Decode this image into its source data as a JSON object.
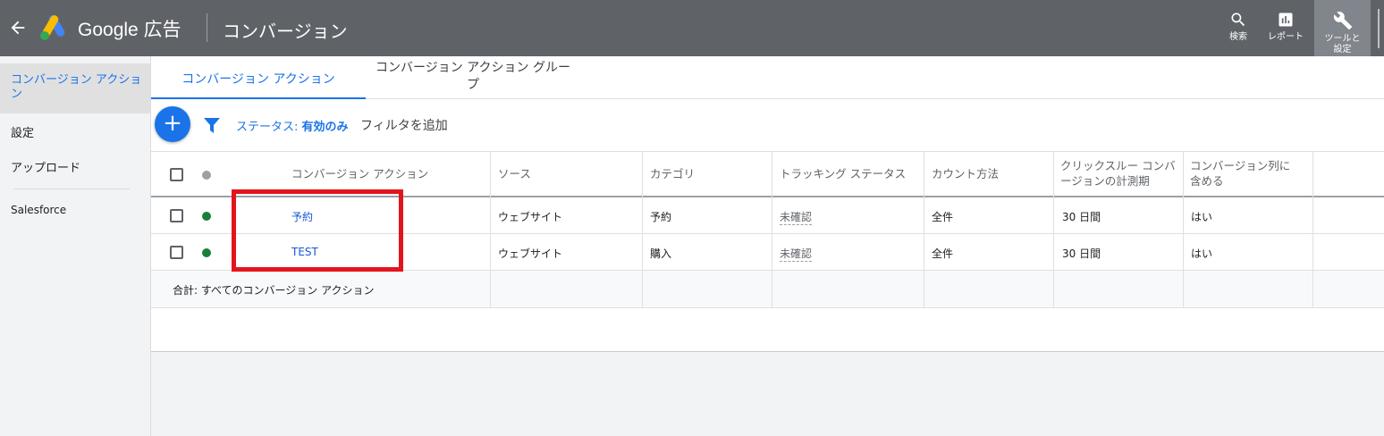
{
  "topbar": {
    "brand": "Google 広告",
    "page_title": "コンバージョン",
    "search_label": "検索",
    "report_label": "レポート",
    "tools_label": "ツールと設定"
  },
  "sidebar": {
    "items": [
      {
        "label": "コンバージョン アクション"
      },
      {
        "label": "設定"
      },
      {
        "label": "アップロード"
      },
      {
        "label": "Salesforce"
      }
    ]
  },
  "tabs": [
    {
      "label": "コンバージョン アクション"
    },
    {
      "label": "コンバージョン アクション グループ"
    }
  ],
  "filters": {
    "status_prefix": "ステータス:",
    "status_value": "有効のみ",
    "add_filter": "フィルタを追加"
  },
  "table": {
    "headers": {
      "action": "コンバージョン アクション",
      "source": "ソース",
      "category": "カテゴリ",
      "tracking": "トラッキング ステータス",
      "count": "カウント方法",
      "click_through": "クリックスルー コンバージョンの計測期",
      "include": "コンバージョン列に含める"
    },
    "rows": [
      {
        "action": "予約",
        "source": "ウェブサイト",
        "category": "予約",
        "tracking": "未確認",
        "count": "全件",
        "click_through": "30 日間",
        "include": "はい"
      },
      {
        "action": "TEST",
        "source": "ウェブサイト",
        "category": "購入",
        "tracking": "未確認",
        "count": "全件",
        "click_through": "30 日間",
        "include": "はい"
      }
    ],
    "total_label": "合計: すべてのコンバージョン アクション"
  },
  "colors": {
    "topbar": "#5f6368",
    "accent": "#1a73e8",
    "highlight_box": "#e3141c",
    "status_active": "#188038"
  }
}
